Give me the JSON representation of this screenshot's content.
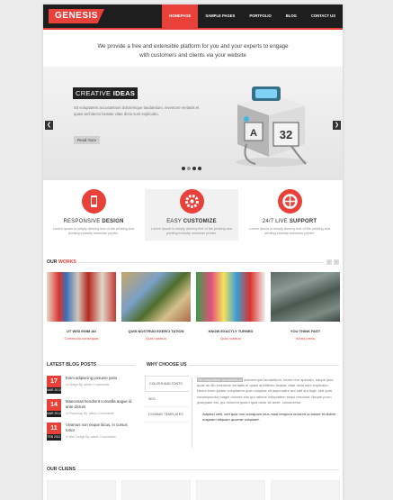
{
  "brand": {
    "name": "GENESIS",
    "accent": "#e8413a",
    "dark": "#1e1e1e"
  },
  "nav": [
    {
      "label": "HOMEPAGE",
      "active": true
    },
    {
      "label": "SAMPLE PAGES",
      "active": false
    },
    {
      "label": "PORTFOLIO",
      "active": false
    },
    {
      "label": "BLOG",
      "active": false
    },
    {
      "label": "CONTACT US",
      "active": false
    }
  ],
  "intro": {
    "line1": "We provide a free and extensible platform for you and your experts to engage",
    "line2": "with customers and clients via your website"
  },
  "slider": {
    "title_a": "CREATIVE",
    "title_b": "IDEAS",
    "text": "Sit voluptatem accusantium doloremque laudantium, inventore veritatis et quasi architecto beatae vitae dicta sunt explicabo.",
    "button": "Read more",
    "prev": "❮",
    "next": "❯",
    "image_icon": "printer-robot-illustration"
  },
  "features": [
    {
      "title_a": "RESPONSIVE ",
      "title_b": "DESIGN",
      "text": "Lorem Ipsum is simply dummy text of the printing and printing industry unknown printer.",
      "icon": "mobile-icon"
    },
    {
      "title_a": "EASY ",
      "title_b": "CUSTOMIZE",
      "text": "Lorem Ipsum is simply dummy text of the printing and printing industry unknown printer.",
      "icon": "gear-icon"
    },
    {
      "title_a": "24/7 LIVE ",
      "title_b": "SUPPORT",
      "text": "Lorem Ipsum is simply dummy text of the printing and printing industry unknown printer.",
      "icon": "lifebuoy-icon"
    }
  ],
  "works": {
    "title_a": "OUR ",
    "title_b": "WORKS",
    "items": [
      {
        "title": "UT WISI ENIM AD",
        "category": "Commodo consequat"
      },
      {
        "title": "QUIS NOSTRUD EXERCI TATION",
        "category": "Quis nostrud"
      },
      {
        "title": "KNOW EXACTLY TURNED",
        "category": "Quis nostrud"
      },
      {
        "title": "YOU THINK FAST",
        "category": "World press"
      }
    ]
  },
  "blog": {
    "title": "LATEST BLOG POSTS",
    "posts": [
      {
        "day": "17",
        "month": "MAR 2013",
        "title": "Enim adipiscing posuere justo",
        "meta": "in Design  By: admin  0 comments"
      },
      {
        "day": "14",
        "month": "MAR 2013",
        "title": "Maecenas hendrerit convallis augue id ante dictum",
        "meta": "in Photoshop  By: admin  3 comments"
      },
      {
        "day": "11",
        "month": "FEB 2013",
        "title": "Vivamus non neque lacus, in cursus tortor",
        "meta": "in Web Design  By: admin  0 comments"
      }
    ]
  },
  "why": {
    "title": "WHY CHOOSE US",
    "tabs": [
      "COLORS AND FONTS",
      "SEO",
      "DYNAMIC TEMPLATES"
    ],
    "highlight": "Sit voluptatem accusantium",
    "text": "doloremque laudantium, totam rem aperiam, eaque ipsa quae ab illo inventore veritatis et quasi architecto beatae vitae dicta sunt explicabo. Nemo enim ipsam voluptatem quia voluptas sit aspernatur aut odit aut fugit, sed quia consequuntur magni dolores eos qui ratione voluptatem sequi nesciunt. Neque porro quisquam est, qui dolorem ipsum quia dolor sit amet, consectetur.",
    "quote": "Adipisci velit, sed quia non numquam eius modi tempora incidunt ut labore et dolore magnam aliquam quaerat voluptate."
  },
  "clients": {
    "title": "OUR CLIENS"
  }
}
